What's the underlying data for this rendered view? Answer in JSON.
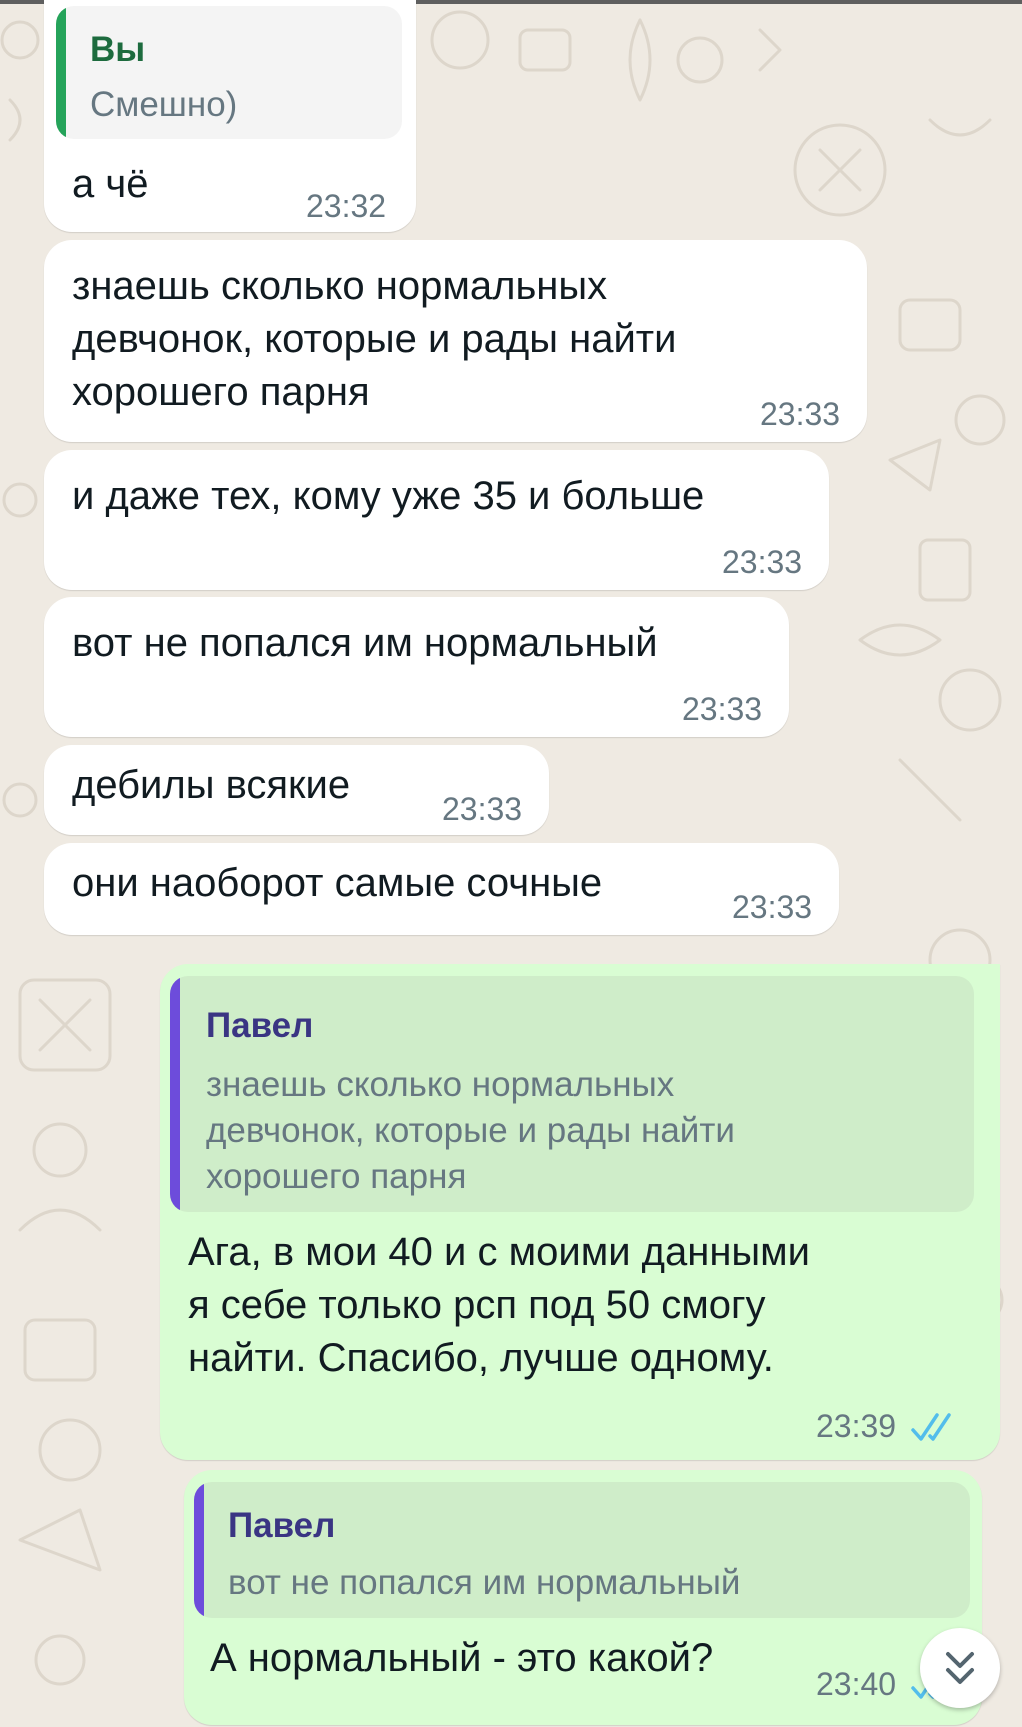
{
  "colors": {
    "wallpaper": "#efeae2",
    "incoming_bubble": "#ffffff",
    "outgoing_bubble": "#d9fdd3",
    "self_quote_accent": "#25a35a",
    "contact_quote_accent": "#6d4cdb",
    "read_ticks": "#53bdeb"
  },
  "messages": [
    {
      "quote_name": "Вы",
      "quote_text": "Смешно)",
      "text": "а чё",
      "time": "23:32"
    },
    {
      "text_lines": [
        "знаешь сколько нормальных",
        "девчонок, которые и рады найти",
        "хорошего парня"
      ],
      "time": "23:33"
    },
    {
      "text": "и даже тех, кому уже 35 и больше",
      "time": "23:33"
    },
    {
      "text": "вот не попался им нормальный",
      "time": "23:33"
    },
    {
      "text": "дебилы всякие",
      "time": "23:33"
    },
    {
      "text": "они наоборот самые сочные",
      "time": "23:33"
    },
    {
      "quote_name": "Павел",
      "quote_lines": [
        "знаешь сколько нормальных",
        "девчонок, которые и рады найти",
        "хорошего парня"
      ],
      "text_lines": [
        "Ага, в мои 40 и с моими данными",
        "я себе только рсп под 50 смогу",
        "найти. Спасибо, лучше одному."
      ],
      "time": "23:39",
      "status": "read"
    },
    {
      "quote_name": "Павел",
      "quote_text": "вот не попался им нормальный",
      "text": "А нормальный - это какой?",
      "time": "23:40",
      "status": "read"
    }
  ],
  "icons": {
    "read_receipt": "double-check-icon",
    "scroll_down": "chevron-double-down-icon"
  }
}
